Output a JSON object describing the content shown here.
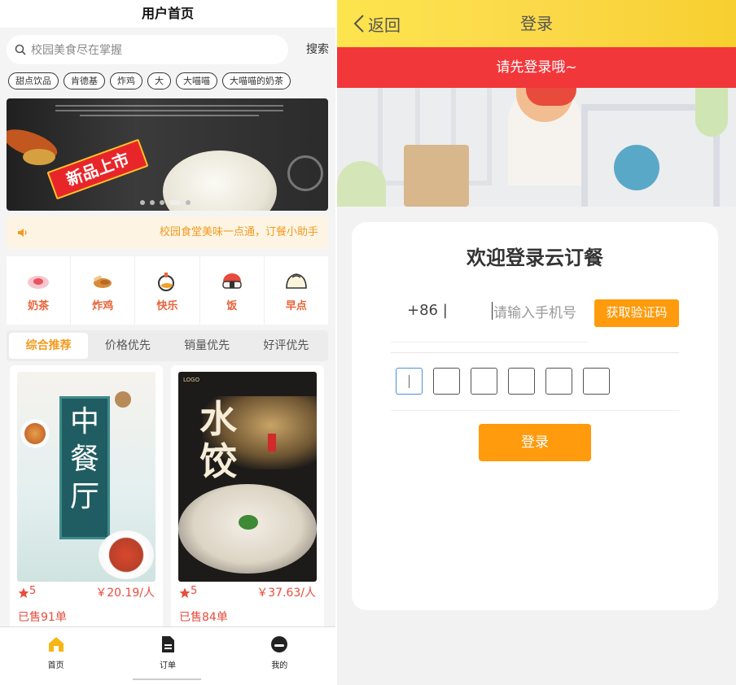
{
  "home": {
    "title": "用户首页",
    "search": {
      "placeholder": "校园美食尽在掌握",
      "button_label": "搜索"
    },
    "tags": [
      "甜点饮品",
      "肯德基",
      "炸鸡",
      "大",
      "大喵喵",
      "大喵喵的奶茶"
    ],
    "banner": {
      "badge_text": "新品上市"
    },
    "notice": {
      "text": "校园食堂美味一点通，订餐小助手"
    },
    "categories": [
      {
        "label": "奶茶",
        "icon": "milk-tea-icon"
      },
      {
        "label": "炸鸡",
        "icon": "fried-chicken-icon"
      },
      {
        "label": "快乐",
        "icon": "happy-meal-icon"
      },
      {
        "label": "饭",
        "icon": "rice-icon"
      },
      {
        "label": "早点",
        "icon": "bun-icon"
      }
    ],
    "sort_tabs": [
      "综合推荐",
      "价格优先",
      "销量优先",
      "好评优先"
    ],
    "active_sort": "综合推荐",
    "products": [
      {
        "poster_text": "中餐厅",
        "rating": "5",
        "price": "￥20.19/人",
        "sold": "已售91单"
      },
      {
        "poster_text": "水饺",
        "rating": "5",
        "price": "￥37.63/人",
        "sold": "已售84单"
      }
    ],
    "tabbar": [
      {
        "label": "首页",
        "icon": "home-icon"
      },
      {
        "label": "订单",
        "icon": "order-icon"
      },
      {
        "label": "我的",
        "icon": "profile-icon"
      }
    ]
  },
  "login": {
    "back_label": "返回",
    "title": "登录",
    "alert": "请先登录哦~",
    "card_title": "欢迎登录云订餐",
    "country_code": "+86 |",
    "phone_placeholder": "请输入手机号",
    "get_code_label": "获取验证码",
    "code_length": 6,
    "login_button": "登录"
  },
  "colors": {
    "accent_orange": "#ff9b0c",
    "header_yellow": "#fbd94a",
    "alert_red": "#f2373b",
    "price_red": "#e74c3c",
    "category_orange": "#e8643a"
  }
}
